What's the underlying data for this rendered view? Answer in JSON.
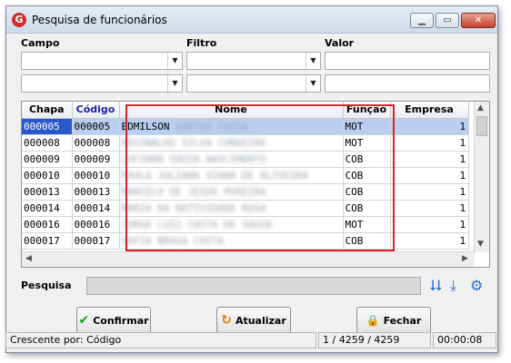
{
  "window": {
    "title": "Pesquisa de funcionários",
    "app_icon": "G",
    "controls": {
      "minimize": "▁",
      "maximize": "▭",
      "close": "✕"
    }
  },
  "filters": {
    "labels": {
      "campo": "Campo",
      "filtro": "Filtro",
      "valor": "Valor"
    },
    "rows": [
      {
        "campo": "",
        "filtro": "",
        "valor": ""
      },
      {
        "campo": "",
        "filtro": "",
        "valor": ""
      }
    ]
  },
  "grid": {
    "columns": [
      "Chapa",
      "Código",
      "Nome",
      "Função",
      "Empresa"
    ],
    "rows": [
      {
        "chapa": "000005",
        "codigo": "000005",
        "nome": "EDMILSON",
        "nome_hidden": "SANTOS COSTA",
        "funcao": "MOT",
        "empresa": "1"
      },
      {
        "chapa": "000008",
        "codigo": "000008",
        "nome": "",
        "nome_hidden": "REGINALDO SILVA CORDEIRO",
        "funcao": "MOT",
        "empresa": "1"
      },
      {
        "chapa": "000009",
        "codigo": "000009",
        "nome": "",
        "nome_hidden": "LUCIANO SOUZA NASCIMENTO",
        "funcao": "COB",
        "empresa": "1"
      },
      {
        "chapa": "000010",
        "codigo": "000010",
        "nome": "",
        "nome_hidden": "PAULA JULIANA VIANA DE OLIVEIRA",
        "funcao": "COB",
        "empresa": "1"
      },
      {
        "chapa": "000013",
        "codigo": "000013",
        "nome": "",
        "nome_hidden": "MARCELO DE JESUS PEREIRA",
        "funcao": "COB",
        "empresa": "1"
      },
      {
        "chapa": "000014",
        "codigo": "000014",
        "nome": "",
        "nome_hidden": "MARIA DA NATIVIDADE ROSA",
        "funcao": "COB",
        "empresa": "1"
      },
      {
        "chapa": "000016",
        "codigo": "000016",
        "nome": "",
        "nome_hidden": "JORGE LUIZ COSTA DE SOUZA",
        "funcao": "MOT",
        "empresa": "1"
      },
      {
        "chapa": "000017",
        "codigo": "000017",
        "nome": "",
        "nome_hidden": "SOFIA BRAGA COSTA",
        "funcao": "COB",
        "empresa": "1"
      }
    ],
    "selected_index": 0
  },
  "search": {
    "label": "Pesquisa",
    "value": ""
  },
  "toolbar_icons": [
    "expand-all-icon",
    "collapse-to-icon",
    "settings-gear-icon"
  ],
  "buttons": {
    "confirm": {
      "label": "Confirmar",
      "icon": "✔"
    },
    "refresh": {
      "label": "Atualizar",
      "icon": "↻"
    },
    "close": {
      "label": "Fechar",
      "icon": "🔒"
    }
  },
  "statusbar": {
    "sort_label": "Crescente por:",
    "sort_field": "Código",
    "position": "1 / 4259 / 4259",
    "elapsed": "00:00:08"
  },
  "colors": {
    "selection": "#2b58c8",
    "selection_row": "#b9cff2",
    "highlight_border": "#e0202c",
    "accent_blue": "#2a6fcf"
  }
}
